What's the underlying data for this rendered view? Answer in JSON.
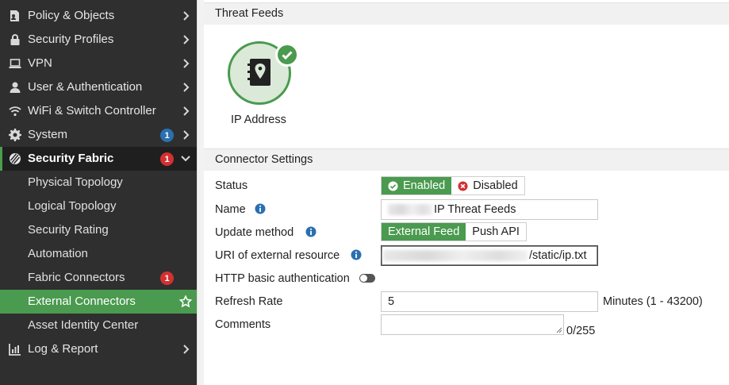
{
  "sidebar": {
    "items": [
      {
        "label": "Policy & Objects",
        "icon": "document-user-icon"
      },
      {
        "label": "Security Profiles",
        "icon": "lock-icon"
      },
      {
        "label": "VPN",
        "icon": "laptop-icon"
      },
      {
        "label": "User & Authentication",
        "icon": "user-icon"
      },
      {
        "label": "WiFi & Switch Controller",
        "icon": "wifi-icon"
      },
      {
        "label": "System",
        "icon": "gear-icon",
        "badge": "1"
      },
      {
        "label": "Security Fabric",
        "icon": "fabric-icon",
        "badge": "1"
      },
      {
        "label": "Log & Report",
        "icon": "chart-icon"
      }
    ],
    "sub_items": [
      {
        "label": "Physical Topology"
      },
      {
        "label": "Logical Topology"
      },
      {
        "label": "Security Rating"
      },
      {
        "label": "Automation"
      },
      {
        "label": "Fabric Connectors",
        "badge": "1"
      },
      {
        "label": "External Connectors"
      },
      {
        "label": "Asset Identity Center"
      }
    ]
  },
  "threat_feeds": {
    "title": "Threat Feeds",
    "feed_label": "IP Address",
    "feed_icon": "address-book-pin-icon",
    "status_icon": "check-circle-icon"
  },
  "connector": {
    "title": "Connector Settings",
    "status_label": "Status",
    "enabled_label": "Enabled",
    "disabled_label": "Disabled",
    "name_label": "Name",
    "name_value": "IP Threat Feeds",
    "update_label": "Update method",
    "external_feed_label": "External Feed",
    "push_api_label": "Push API",
    "uri_label": "URI of external resource",
    "uri_value": "/static/ip.txt",
    "http_auth_label": "HTTP basic authentication",
    "refresh_label": "Refresh Rate",
    "refresh_value": "5",
    "refresh_hint": "Minutes (1 - 43200)",
    "comments_label": "Comments",
    "comments_count": "0/255"
  },
  "colors": {
    "sidebar_bg": "#2f2f2f",
    "accent_green": "#4a9a4f",
    "badge_red": "#d33131",
    "badge_blue": "#2a6fb0",
    "info_blue": "#2a6fb0"
  }
}
